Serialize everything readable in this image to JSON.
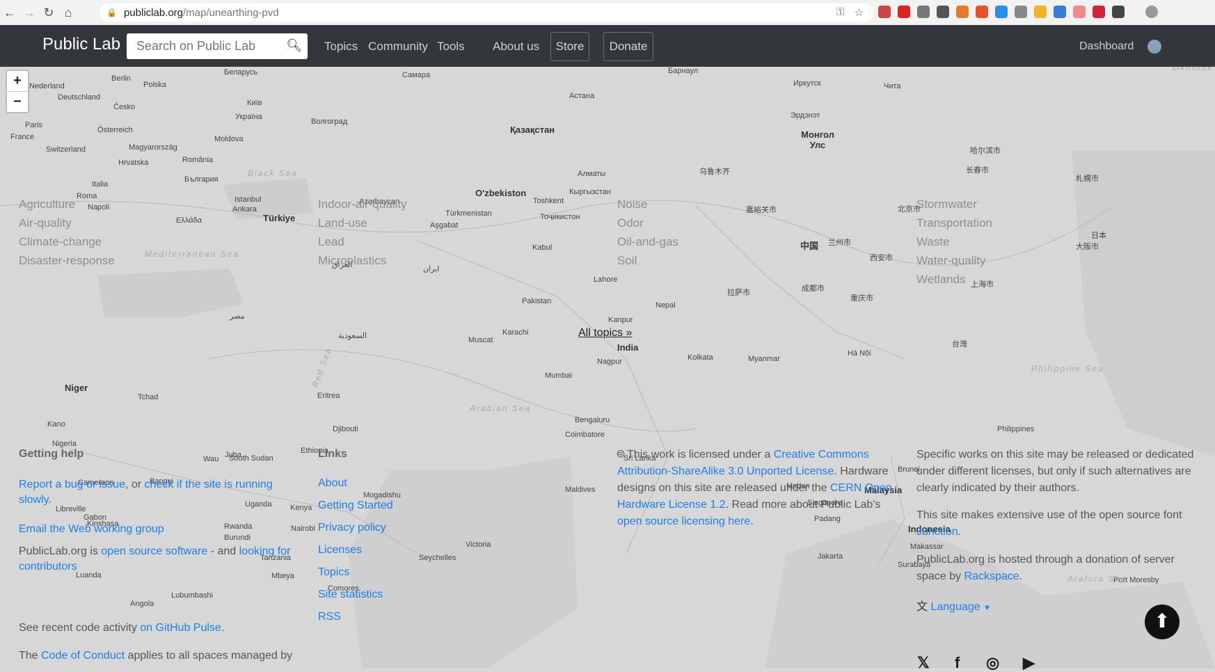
{
  "browser": {
    "url_host": "publiclab.org",
    "url_path": "/map/unearthing-pvd"
  },
  "navbar": {
    "brand": "Public Lab",
    "search_placeholder": "Search on Public Lab",
    "links": [
      "Topics",
      "Community",
      "Tools",
      "About us"
    ],
    "store": "Store",
    "donate": "Donate",
    "dashboard": "Dashboard"
  },
  "zoom": {
    "in": "+",
    "out": "−"
  },
  "topics_col1": [
    "Agriculture",
    "Air-quality",
    "Climate-change",
    "Disaster-response"
  ],
  "topics_col2": [
    "Indoor-air-quality",
    "Land-use",
    "Lead",
    "Microplastics"
  ],
  "topics_col3": [
    "Noise",
    "Odor",
    "Oil-and-gas",
    "Soil"
  ],
  "topics_col4": [
    "Stormwater",
    "Transportation",
    "Waste",
    "Water-quality",
    "Wetlands"
  ],
  "all_topics": "All topics »",
  "help": {
    "title": "Getting help",
    "report_bug": "Report a bug or issue",
    "or": ", or ",
    "check_running": "check if the site is running slowly",
    "period": ".",
    "email_group": "Email the Web working group",
    "pl_is": "PublicLab.org is ",
    "open_source": "open source software",
    "and": " - and ",
    "looking": "looking for contributors",
    "recent": "See recent code activity ",
    "pulse": "on GitHub Pulse",
    "the": "The ",
    "coc": "Code of Conduct",
    "applies": " applies to all spaces managed by"
  },
  "links": {
    "title": "Links",
    "items": [
      "About",
      "Getting Started",
      "Privacy policy",
      "Licenses",
      "Topics",
      "Site statistics",
      "RSS"
    ]
  },
  "license": {
    "cc": "🅭",
    "t1": "This work is licensed under a ",
    "l1": "Creative Commons Attribution-ShareAlike 3.0 Unported License",
    "t2": ". Hardware designs on this site are released under the ",
    "l2": "CERN Open Hardware License 1.2",
    "t3": ". Read more about Public Lab's ",
    "l3": "open source licensing here",
    "t4": "."
  },
  "right_col": {
    "p1": "Specific works on this site may be released or dedicated under different licenses, but only if such alternatives are clearly indicated by their authors.",
    "p2a": "This site makes extensive use of the open source font ",
    "p2link": "Junction",
    "p2b": ".",
    "p3a": "PublicLab.org is hosted through a donation of server space by ",
    "p3link": "Rackspace",
    "p3b": ".",
    "language": "Language"
  },
  "map_labels": [
    "Berlin",
    "Polska",
    "Nederland",
    "Deutschland",
    "Česko",
    "Paris",
    "France",
    "Österreich",
    "Magyarország",
    "Switzerland",
    "Hrvatska",
    "România",
    "Україна",
    "Київ",
    "Moldova",
    "Беларусь",
    "Волгоград",
    "Самара",
    "Қазақстан",
    "Астана",
    "Барнаул",
    "Иркутск",
    "Чита",
    "Монгол Улс",
    "Эрдэнэт",
    "Italia",
    "Roma",
    "Napoli",
    "България",
    "Istanbul",
    "Ankara",
    "Türkiye",
    "Ελλάδα",
    "O'zbekiston",
    "Алматы",
    "Кыргызстан",
    "Türkmenistan",
    "Toshkent",
    "Тоҷикистон",
    "Aşgabat",
    "Azərbaycan",
    "乌鲁木齐",
    "嘉峪关市",
    "北京市",
    "哈尔滨市",
    "长春市",
    "札幌市",
    "中国",
    "兰州市",
    "西安市",
    "成都市",
    "重庆市",
    "拉萨市",
    "上海市",
    "台灣",
    "Kabul",
    "Lahore",
    "Pakistan",
    "Karachi",
    "India",
    "Nepal",
    "Kanpur",
    "Kolkata",
    "Nagpur",
    "Mumbai",
    "Bengaluru",
    "Coimbatore",
    "Sri Lanka",
    "Maldives",
    "Myanmar",
    "Hà Nội",
    "Malaysia",
    "Singapore",
    "Indonesia",
    "Jakarta",
    "Surabaya",
    "Makassar",
    "Medan",
    "Padang",
    "Brunei",
    "Philippines",
    "日本",
    "大阪市",
    "Muscat",
    "ایران",
    "العراق",
    "السعودية",
    "مصر",
    "Niger",
    "Tchad",
    "Nigeria",
    "Kano",
    "Ethiopia",
    "Kenya",
    "Nairobi",
    "Uganda",
    "Tanzania",
    "Mogadishu",
    "Djibouti",
    "Eritrea",
    "Kinshasa",
    "Luanda",
    "Victoria",
    "Seychelles",
    "Comores",
    "Port Moresby",
    "Mbeya",
    "Lubumbashi",
    "Angola",
    "Gabon",
    "Libreville",
    "Cameroon",
    "Bangui",
    "Juba",
    "South Sudan",
    "Wau",
    "Rwanda",
    "Burundi",
    "Black Sea",
    "Mediterranean Sea",
    "Arabian Sea",
    "Red Sea",
    "Philippine Sea",
    "Okhotsk",
    "Arafura Sea"
  ]
}
